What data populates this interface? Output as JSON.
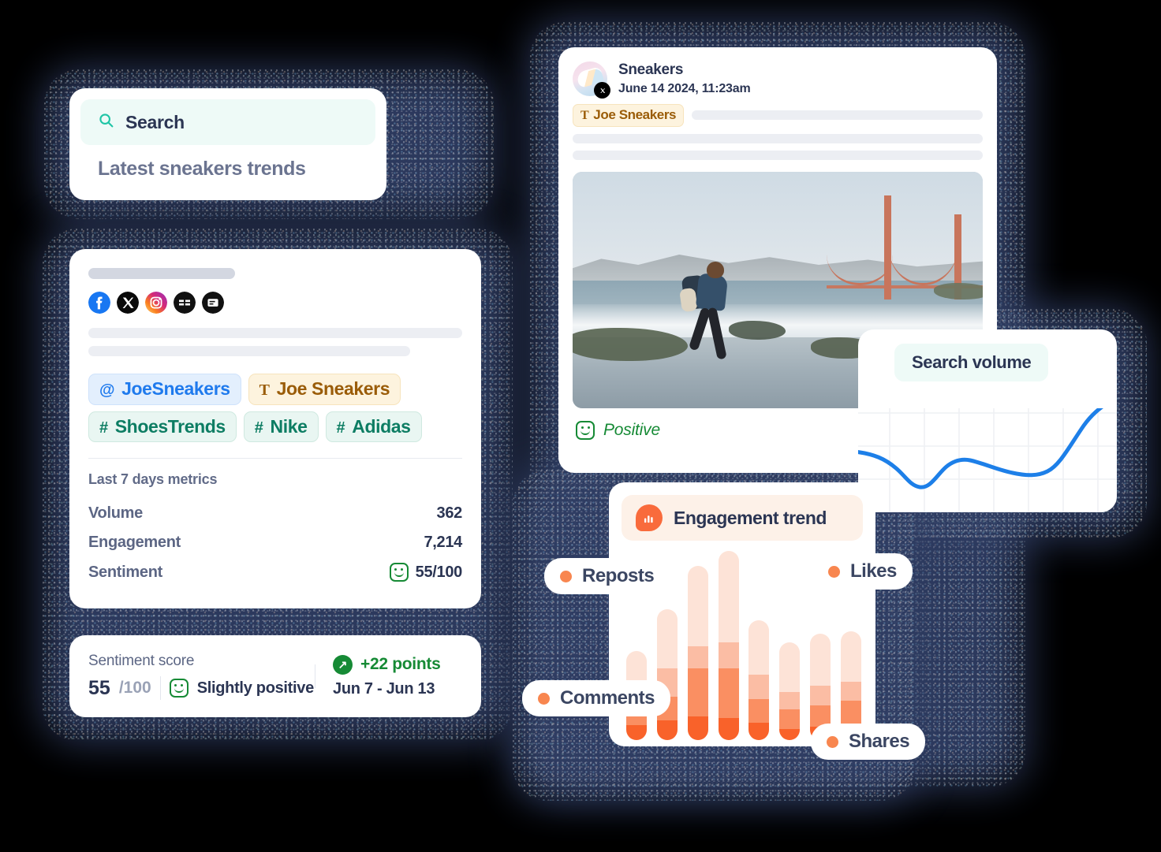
{
  "search": {
    "icon": "search-icon",
    "label": "Search",
    "query": "Latest sneakers trends"
  },
  "profile": {
    "social_icons": [
      "facebook-icon",
      "x-icon",
      "instagram-icon",
      "news-icon",
      "blog-icon"
    ],
    "tags": [
      {
        "type": "mention",
        "symbol": "@",
        "label": "JoeSneakers"
      },
      {
        "type": "author",
        "symbol": "T",
        "label": "Joe Sneakers"
      },
      {
        "type": "hashtag",
        "symbol": "#",
        "label": "ShoesTrends"
      },
      {
        "type": "hashtag",
        "symbol": "#",
        "label": "Nike"
      },
      {
        "type": "hashtag",
        "symbol": "#",
        "label": "Adidas"
      }
    ],
    "metrics_title": "Last 7 days metrics",
    "metrics": [
      {
        "key": "Volume",
        "value": "362",
        "icon": ""
      },
      {
        "key": "Engagement",
        "value": "7,214",
        "icon": ""
      },
      {
        "key": "Sentiment",
        "value": "55/100",
        "icon": "smiley-icon"
      }
    ]
  },
  "score_card": {
    "label": "Sentiment score",
    "score": "55",
    "denominator": "/100",
    "mood_icon": "smiley-icon",
    "mood": "Slightly positive",
    "delta_icon": "arrow-up-right-icon",
    "delta": "+22 points",
    "range": "Jun 7 - Jun 13"
  },
  "post": {
    "avatar": "sneaker-avatar",
    "network_badge": "x-icon",
    "name": "Sneakers",
    "date": "June 14 2024, 11:23am",
    "author_tag": {
      "symbol": "T",
      "label": "Joe Sneakers"
    },
    "photo_alt": "hiker-on-beach-golden-gate-bridge",
    "sentiment_icon": "smiley-icon",
    "sentiment": "Positive"
  },
  "search_volume": {
    "title": "Search volume"
  },
  "engagement": {
    "icon": "chart-bubble-icon",
    "title": "Engagement trend",
    "legend": [
      {
        "name": "Reposts",
        "color": "#f8864f"
      },
      {
        "name": "Likes",
        "color": "#f8864f"
      },
      {
        "name": "Comments",
        "color": "#f8864f"
      },
      {
        "name": "Shares",
        "color": "#f8864f"
      }
    ],
    "colors": {
      "likes": "#fde3d7",
      "reposts": "#fbbda4",
      "comments": "#fa8f62",
      "shares": "#f9622a"
    }
  },
  "chart_data": [
    {
      "type": "line",
      "title": "Search volume",
      "x": [
        0,
        1,
        2,
        3,
        4,
        5,
        6,
        7,
        8,
        9
      ],
      "values": [
        62,
        56,
        44,
        30,
        26,
        40,
        52,
        48,
        44,
        46
      ],
      "series": [
        {
          "name": "Search volume",
          "values": [
            62,
            56,
            44,
            30,
            26,
            40,
            52,
            48,
            44,
            46,
            96
          ]
        }
      ],
      "xlabel": "",
      "ylabel": "",
      "grid": true,
      "legend": "none",
      "line_color": "#1d7fe8"
    },
    {
      "type": "bar",
      "subtype": "stacked",
      "title": "Engagement trend",
      "categories": [
        "1",
        "2",
        "3",
        "4",
        "5",
        "6",
        "7",
        "8"
      ],
      "series": [
        {
          "name": "Shares",
          "color": "#f9622a",
          "values": [
            14,
            18,
            22,
            20,
            16,
            10,
            12,
            14
          ]
        },
        {
          "name": "Comments",
          "color": "#fa8f62",
          "values": [
            8,
            22,
            44,
            46,
            22,
            18,
            20,
            22
          ]
        },
        {
          "name": "Reposts",
          "color": "#fbbda4",
          "values": [
            14,
            26,
            20,
            24,
            22,
            16,
            18,
            18
          ]
        },
        {
          "name": "Likes",
          "color": "#fde3d7",
          "values": [
            46,
            54,
            74,
            84,
            50,
            46,
            48,
            46
          ]
        }
      ],
      "xlabel": "",
      "ylabel": "",
      "grid": false,
      "legend": "floating"
    }
  ]
}
